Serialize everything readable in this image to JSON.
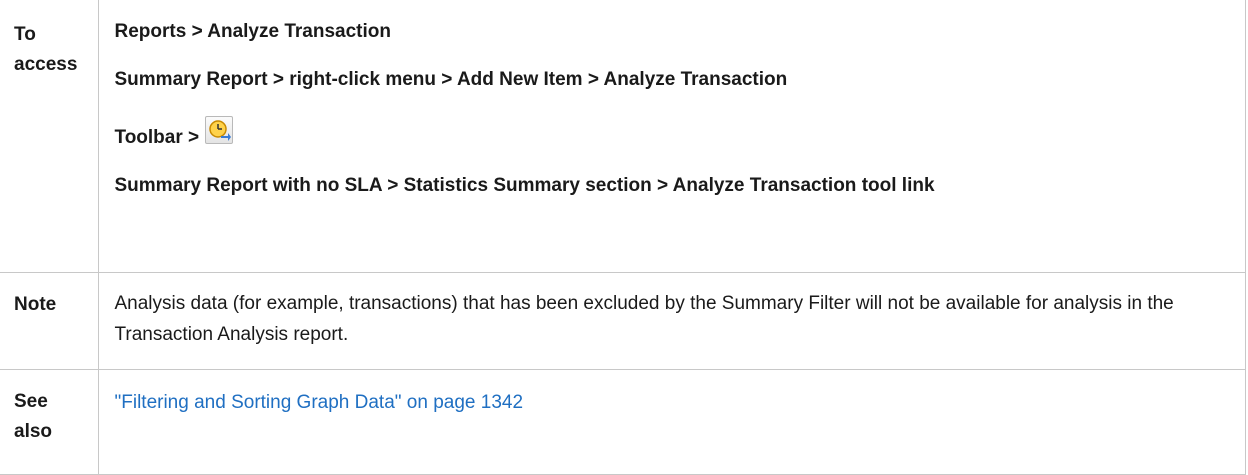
{
  "rows": {
    "access": {
      "label": "To access",
      "lines": [
        "Reports > Analyze Transaction",
        "Summary Report > right-click menu > Add New Item > Analyze Transaction",
        "Toolbar >",
        "Summary Report with no SLA > Statistics Summary section > Analyze Transaction tool link"
      ],
      "toolbar_icon": "analyze-transaction-clock-icon"
    },
    "note": {
      "label": "Note",
      "text": "Analysis data (for example, transactions) that has been excluded by the Summary Filter will not be available for analysis in the Transaction Analysis report."
    },
    "see_also": {
      "label": "See also",
      "link_text": "\"Filtering and Sorting Graph Data\" on page 1342"
    }
  },
  "colors": {
    "link": "#1f6fc2",
    "border": "#c8c8c8",
    "icon_clock": "#e8a000"
  }
}
